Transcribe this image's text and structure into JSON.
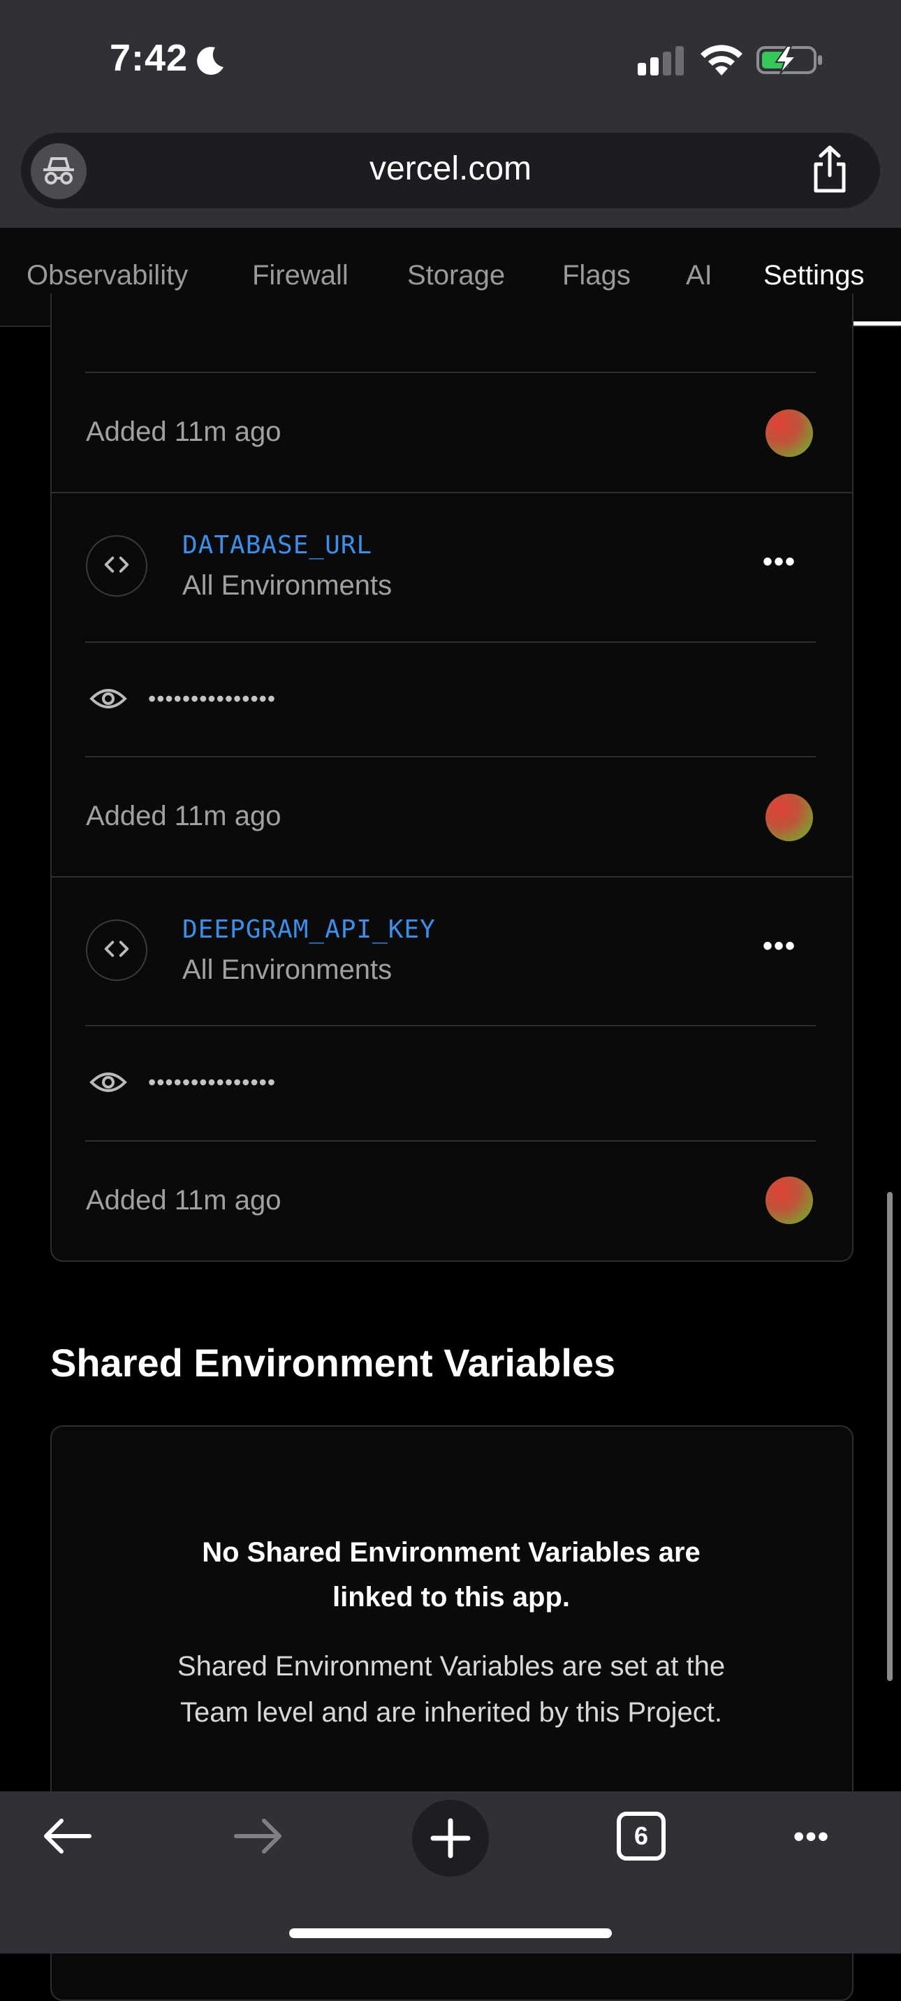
{
  "status_bar": {
    "time": "7:42"
  },
  "browser": {
    "url": "vercel.com",
    "tab_count": "6"
  },
  "tabs": [
    {
      "label": "Observability",
      "active": false
    },
    {
      "label": "Firewall",
      "active": false
    },
    {
      "label": "Storage",
      "active": false
    },
    {
      "label": "Flags",
      "active": false
    },
    {
      "label": "AI",
      "active": false
    },
    {
      "label": "Settings",
      "active": true
    }
  ],
  "env_vars": [
    {
      "added": "Added 11m ago"
    },
    {
      "name": "DATABASE_URL",
      "environments": "All Environments",
      "masked_value": "•••••••••••••••",
      "added": "Added 11m ago"
    },
    {
      "name": "DEEPGRAM_API_KEY",
      "environments": "All Environments",
      "masked_value": "•••••••••••••••",
      "added": "Added 11m ago"
    }
  ],
  "shared": {
    "title": "Shared Environment Variables",
    "empty_title": "No Shared Environment Variables are linked to this app.",
    "empty_desc": "Shared Environment Variables are set at the Team level and are inherited by this Project."
  },
  "colors": {
    "accent_blue": "#3b8eea",
    "background": "#000000",
    "chrome": "#2f3136"
  }
}
